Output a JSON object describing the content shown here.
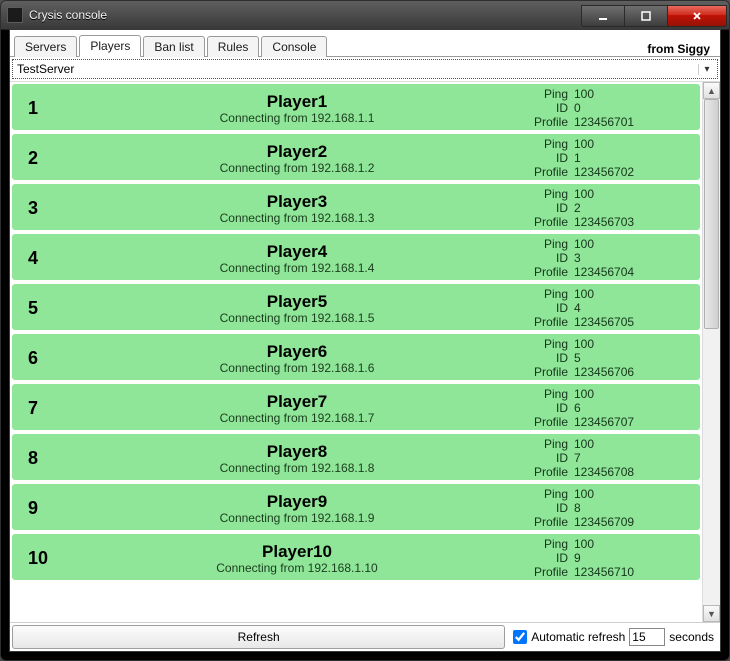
{
  "window": {
    "title": "Crysis console",
    "from_label": "from Siggy"
  },
  "tabs": [
    {
      "label": "Servers",
      "active": false
    },
    {
      "label": "Players",
      "active": true
    },
    {
      "label": "Ban list",
      "active": false
    },
    {
      "label": "Rules",
      "active": false
    },
    {
      "label": "Console",
      "active": false
    }
  ],
  "server_select": {
    "value": "TestServer"
  },
  "stat_labels": {
    "ping": "Ping",
    "id": "ID",
    "profile": "Profile"
  },
  "connecting_prefix": "Connecting from ",
  "players": [
    {
      "idx": "1",
      "name": "Player1",
      "ip": "192.168.1.1",
      "ping": "100",
      "id": "0",
      "profile": "123456701"
    },
    {
      "idx": "2",
      "name": "Player2",
      "ip": "192.168.1.2",
      "ping": "100",
      "id": "1",
      "profile": "123456702"
    },
    {
      "idx": "3",
      "name": "Player3",
      "ip": "192.168.1.3",
      "ping": "100",
      "id": "2",
      "profile": "123456703"
    },
    {
      "idx": "4",
      "name": "Player4",
      "ip": "192.168.1.4",
      "ping": "100",
      "id": "3",
      "profile": "123456704"
    },
    {
      "idx": "5",
      "name": "Player5",
      "ip": "192.168.1.5",
      "ping": "100",
      "id": "4",
      "profile": "123456705"
    },
    {
      "idx": "6",
      "name": "Player6",
      "ip": "192.168.1.6",
      "ping": "100",
      "id": "5",
      "profile": "123456706"
    },
    {
      "idx": "7",
      "name": "Player7",
      "ip": "192.168.1.7",
      "ping": "100",
      "id": "6",
      "profile": "123456707"
    },
    {
      "idx": "8",
      "name": "Player8",
      "ip": "192.168.1.8",
      "ping": "100",
      "id": "7",
      "profile": "123456708"
    },
    {
      "idx": "9",
      "name": "Player9",
      "ip": "192.168.1.9",
      "ping": "100",
      "id": "8",
      "profile": "123456709"
    },
    {
      "idx": "10",
      "name": "Player10",
      "ip": "192.168.1.10",
      "ping": "100",
      "id": "9",
      "profile": "123456710"
    }
  ],
  "footer": {
    "refresh_label": "Refresh",
    "auto_label": "Automatic refresh",
    "auto_checked": true,
    "interval": "15",
    "seconds_label": "seconds"
  }
}
